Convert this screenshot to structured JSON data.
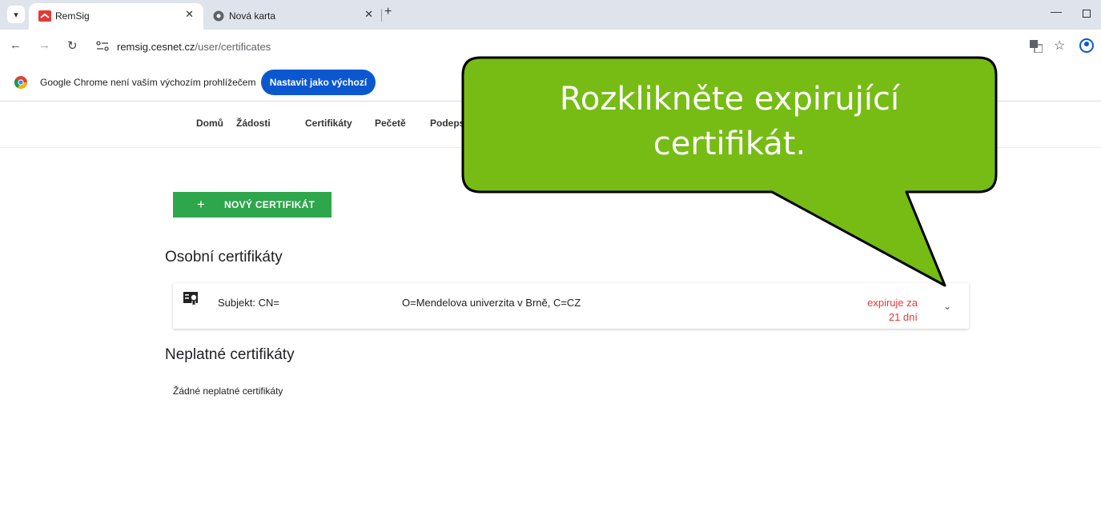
{
  "browser": {
    "tabs": [
      {
        "title": "RemSig",
        "active": true
      },
      {
        "title": "Nová karta",
        "active": false
      }
    ],
    "url_host": "remsig.cesnet.cz",
    "url_path": "/user/certificates",
    "infobar_text": "Google Chrome není vaším výchozím prohlížečem",
    "infobar_button": "Nastavit jako výchozí"
  },
  "nav": {
    "items": [
      "Domů",
      "Žádosti",
      "Certifikáty",
      "Pečetě",
      "Podeps"
    ]
  },
  "main": {
    "new_cert_label": "NOVÝ CERTIFIKÁT",
    "personal_title": "Osobní certifikáty",
    "cert": {
      "subject": "Subjekt: CN=",
      "org": "O=Mendelova univerzita v Brně, C=CZ",
      "expiry_line1": "expiruje za",
      "expiry_line2": "21 dní"
    },
    "invalid_title": "Neplatné certifikáty",
    "invalid_empty": "Žádné neplatné certifikáty"
  },
  "callout": {
    "line1": "Rozklikněte expirující",
    "line2": "certifikát."
  },
  "colors": {
    "accent_green": "#2ea64c",
    "callout_green": "#76bc14",
    "expiry_red": "#e53935",
    "chrome_blue": "#0b57d0"
  }
}
